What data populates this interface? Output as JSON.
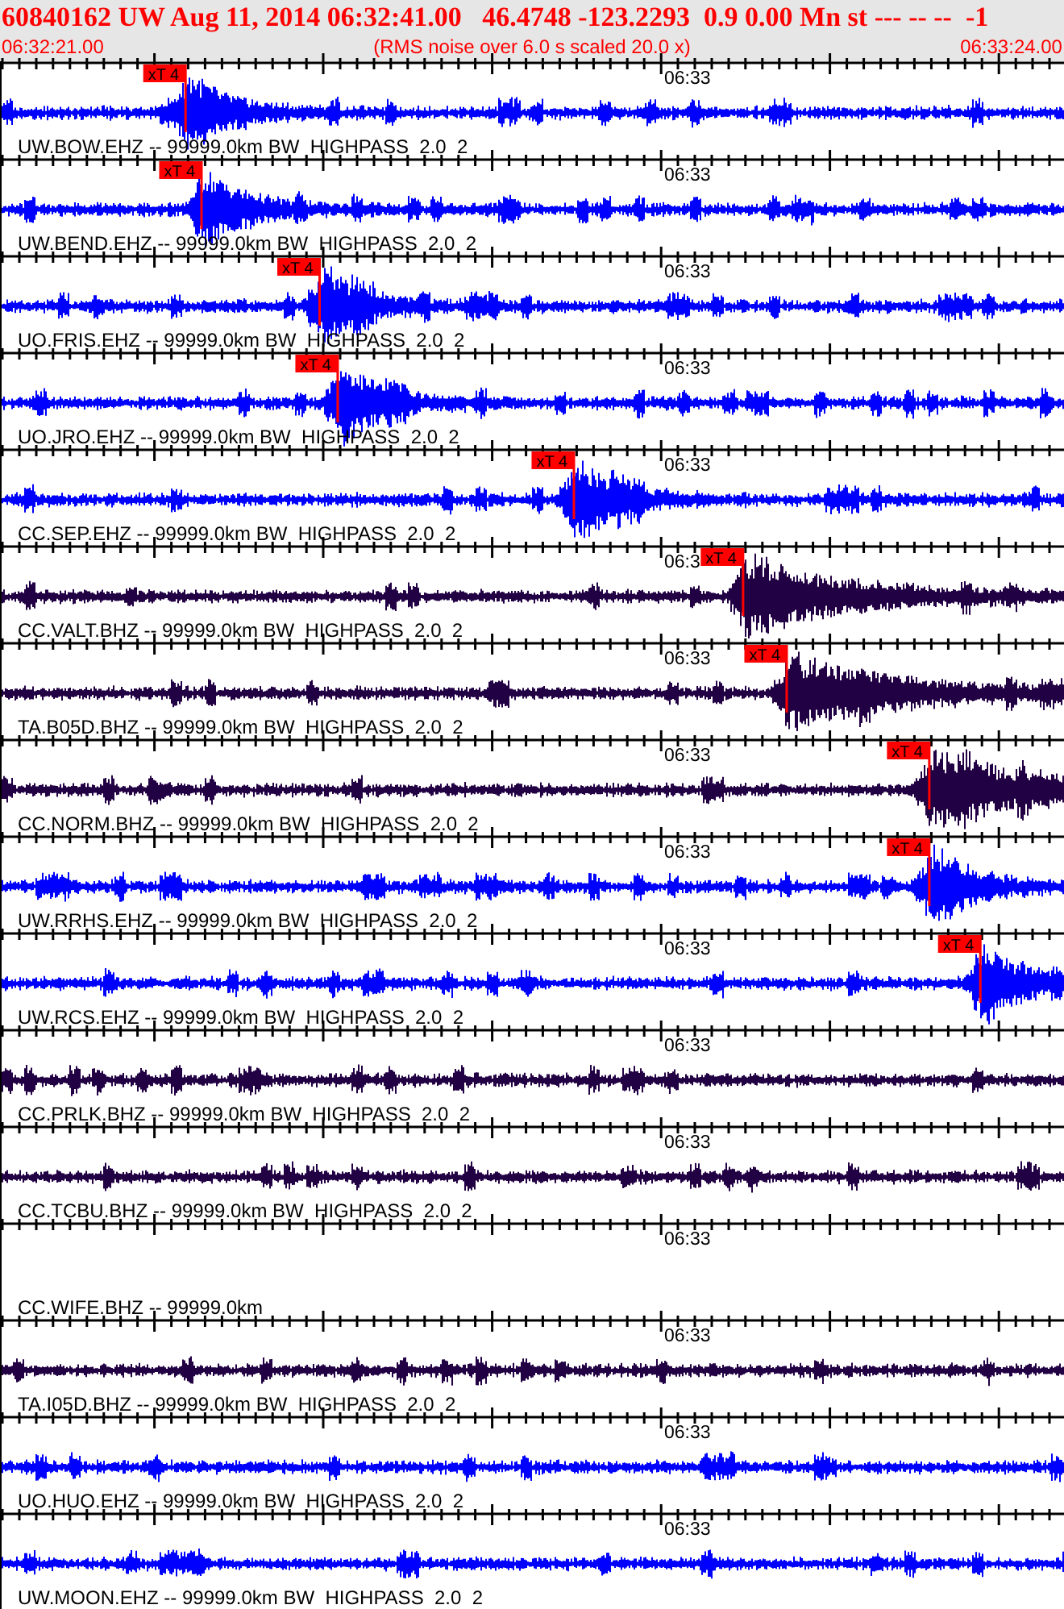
{
  "header": {
    "title": "60840162 UW Aug 11, 2014 06:32:41.00   46.4748 -123.2293  0.9 0.00 Mn st --- -- --  -1",
    "start_time": "06:32:21.00",
    "note": "(RMS noise over 6.0 s scaled 20.0 x)",
    "end_time": "06:33:24.00"
  },
  "traces": [
    {
      "label": "UW.BOW.EHZ -- 99999.0km BW  HIGHPASS  2.0  2",
      "axis_label": "06:33",
      "color": "#0000ff",
      "kind": "signal",
      "pick": {
        "label": "xT 4",
        "level": 0.174
      }
    },
    {
      "label": "UW.BEND.EHZ -- 99999.0km BW  HIGHPASS  2.0  2",
      "axis_label": "06:33",
      "color": "#0000ff",
      "kind": "signal",
      "pick": {
        "label": "xT 4",
        "level": 0.189
      }
    },
    {
      "label": "UO.FRIS.EHZ -- 99999.0km BW  HIGHPASS  2.0  2",
      "axis_label": "06:33",
      "color": "#0000ff",
      "kind": "signal",
      "pick": {
        "label": "xT 4",
        "level": 0.3
      }
    },
    {
      "label": "UO.JRO.EHZ -- 99999.0km BW  HIGHPASS  2.0  2",
      "axis_label": "06:33",
      "color": "#0000ff",
      "kind": "signal",
      "pick": {
        "label": "xT 4",
        "level": 0.317
      }
    },
    {
      "label": "CC.SEP.EHZ -- 99999.0km BW  HIGHPASS  2.0  2",
      "axis_label": "06:33",
      "color": "#0000ff",
      "kind": "signal",
      "pick": {
        "label": "xT 4",
        "level": 0.539
      }
    },
    {
      "label": "CC.VALT.BHZ -- 99999.0km BW  HIGHPASS  2.0  2",
      "axis_label": "06:3",
      "color": "#220044",
      "kind": "signal",
      "pick": {
        "label": "xT 4",
        "level": 0.698
      }
    },
    {
      "label": "TA.B05D.BHZ -- 99999.0km BW  HIGHPASS  2.0  2",
      "axis_label": "06:33",
      "color": "#220044",
      "kind": "signal",
      "pick": {
        "label": "xT 4",
        "level": 0.739
      }
    },
    {
      "label": "CC.NORM.BHZ -- 99999.0km BW  HIGHPASS  2.0  2",
      "axis_label": "06:33",
      "color": "#220044",
      "kind": "signal",
      "pick": {
        "label": "xT 4",
        "level": 0.873
      }
    },
    {
      "label": "UW.RRHS.EHZ -- 99999.0km BW  HIGHPASS  2.0  2",
      "axis_label": "06:33",
      "color": "#0000ff",
      "kind": "signal",
      "pick": {
        "label": "xT 4",
        "level": 0.873
      }
    },
    {
      "label": "UW.RCS.EHZ -- 99999.0km BW  HIGHPASS  2.0  2",
      "axis_label": "06:33",
      "color": "#0000ff",
      "kind": "signal",
      "pick": {
        "label": "xT 4",
        "level": 0.921
      }
    },
    {
      "label": "CC.PRLK.BHZ -- 99999.0km BW  HIGHPASS  2.0  2",
      "axis_label": "06:33",
      "color": "#220044",
      "kind": "signal"
    },
    {
      "label": "CC.TCBU.BHZ -- 99999.0km BW  HIGHPASS  2.0  2",
      "axis_label": "06:33",
      "color": "#220044",
      "kind": "signal"
    },
    {
      "label": "CC.WIFE.BHZ -- 99999.0km",
      "axis_label": "06:33",
      "kind": "empty"
    },
    {
      "label": "TA.I05D.BHZ -- 99999.0km BW  HIGHPASS  2.0  2",
      "axis_label": "06:33",
      "color": "#220044",
      "kind": "signal"
    },
    {
      "label": "UO.HUO.EHZ -- 99999.0km BW  HIGHPASS  2.0  2",
      "axis_label": "06:33",
      "color": "#0000ff",
      "kind": "signal"
    },
    {
      "label": "UW.MOON.EHZ -- 99999.0km BW  HIGHPASS  2.0  2",
      "axis_label": "06:33",
      "color": "#0000ff",
      "kind": "signal"
    }
  ]
}
